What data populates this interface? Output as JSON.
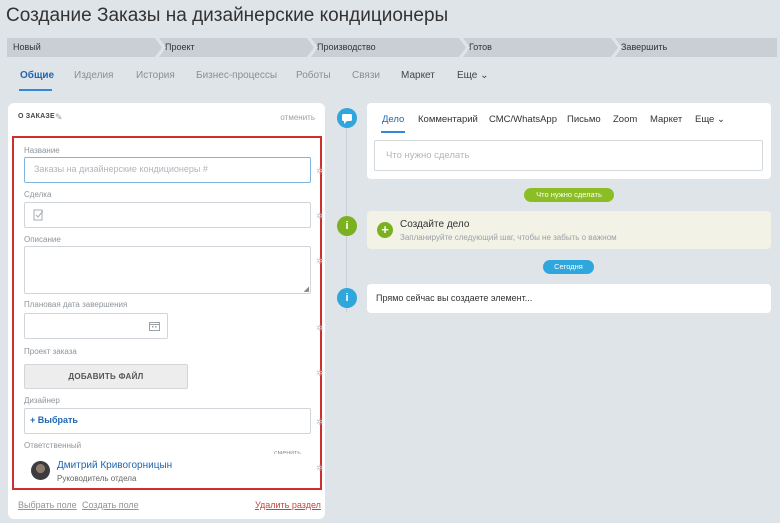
{
  "title": "Создание Заказы на дизайнерские кондиционеры",
  "stages": [
    "Новый",
    "Проект",
    "Производство",
    "Готов",
    "Завершить"
  ],
  "tabs": [
    "Общие",
    "Изделия",
    "История",
    "Бизнес-процессы",
    "Роботы",
    "Связи",
    "Маркет",
    "Еще"
  ],
  "section": {
    "header": "О ЗАКАЗЕ",
    "cancel": "отменить",
    "fields": {
      "name_label": "Название",
      "name_placeholder": "Заказы на дизайнерские кондиционеры #",
      "deal_label": "Сделка",
      "description_label": "Описание",
      "date_label": "Плановая дата завершения",
      "project_label": "Проект заказа",
      "add_file": "ДОБАВИТЬ ФАЙЛ",
      "designer_label": "Дизайнер",
      "designer_pick": "Выбрать",
      "responsible_label": "Ответственный",
      "change": "сменить",
      "user_name": "Дмитрий Кривогорницын",
      "user_role": "Руководитель отдела"
    },
    "footer": {
      "select_field": "Выбрать поле",
      "create_field": "Создать поле",
      "delete_section": "Удалить раздел"
    }
  },
  "activity": {
    "tabs": [
      "Дело",
      "Комментарий",
      "СМС/WhatsApp",
      "Письмо",
      "Zoom",
      "Маркет",
      "Еще"
    ],
    "input_placeholder": "Что нужно сделать",
    "todo_pill": "Что нужно сделать",
    "todo_title": "Создайте дело",
    "todo_subtitle": "Запланируйте следующий шаг, чтобы не забыть о важном",
    "today_pill": "Сегодня",
    "now_text": "Прямо сейчас вы создаете элемент..."
  }
}
